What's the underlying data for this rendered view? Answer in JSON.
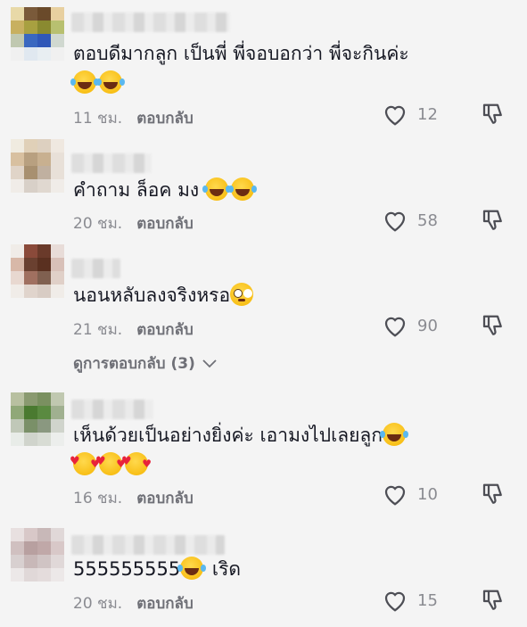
{
  "comments": [
    {
      "text": "ตอบดีมากลูก เป็นพี่ พี่จอบอกว่า พี่จะกินค่ะ",
      "emojis_after": [
        "laugh",
        "laugh"
      ],
      "time": "11 ชม.",
      "reply_label": "ตอบกลับ",
      "likes": "12",
      "avatar": [
        "#e8d9a8",
        "#7a5a3a",
        "#6a4a2a",
        "#e8d0a0",
        "#c8b060",
        "#a8a040",
        "#8a8a30",
        "#b8c070",
        "#c0c8b0",
        "#3a68c0",
        "#3058b8",
        "#d0d8d0",
        "#f0f0f0",
        "#e0e8f0",
        "#e8eef2",
        "#f0f0f0"
      ]
    },
    {
      "text": "คำถาม ล็อค มง",
      "emojis_inline": [
        "laugh",
        "laugh"
      ],
      "time": "20 ชม.",
      "reply_label": "ตอบกลับ",
      "likes": "58",
      "avatar": [
        "#f0ebe0",
        "#e0d0b8",
        "#ddd0c0",
        "#efe8e0",
        "#d8c0a0",
        "#b8a080",
        "#c8b090",
        "#e8e0d8",
        "#e0d4c8",
        "#a89070",
        "#c0b0a0",
        "#e8e0d8",
        "#f0ece8",
        "#d8d0c8",
        "#e0d8d0",
        "#f0ece8"
      ]
    },
    {
      "text": "นอนหลับลงจริงหรอ",
      "emojis_inline": [
        "flush"
      ],
      "time": "21 ชม.",
      "reply_label": "ตอบกลับ",
      "likes": "90",
      "view_replies": "ดูการตอบกลับ (3)",
      "avatar": [
        "#f0ece8",
        "#8a4a3a",
        "#6a3a2a",
        "#e8dcd8",
        "#d8b8a8",
        "#6a4030",
        "#5a3020",
        "#d8c0b8",
        "#e8d8d0",
        "#a07060",
        "#806050",
        "#e0d0c8",
        "#f0ece8",
        "#e0d4cc",
        "#d8ccc4",
        "#f0ece8"
      ]
    },
    {
      "text": "เห็นด้วยเป็นอย่างยิ่งค่ะ เอามงไปเลยลูก",
      "emojis_line2": [
        "hearts",
        "hearts",
        "hearts"
      ],
      "emojis_inline": [
        "laugh"
      ],
      "time": "16 ชม.",
      "reply_label": "ตอบกลับ",
      "likes": "10",
      "avatar": [
        "#b8c0a0",
        "#8a9a70",
        "#7a9060",
        "#c0c8b0",
        "#90a878",
        "#4a7a30",
        "#5a8a40",
        "#a0b090",
        "#c0c8b8",
        "#7a9068",
        "#8a9880",
        "#d0d4cc",
        "#e8ece8",
        "#d0d4cc",
        "#d8dcd4",
        "#eceeec"
      ]
    },
    {
      "text": "555555555",
      "text_after": " เริด",
      "emojis_inline": [
        "laugh"
      ],
      "time": "20 ชม.",
      "reply_label": "ตอบกลับ",
      "likes": "15",
      "avatar": [
        "#e8e0e0",
        "#d8c8c8",
        "#c8b8b8",
        "#e0d8d8",
        "#d0c0c0",
        "#b8a0a0",
        "#c0a8a8",
        "#d8c8c8",
        "#d8d0d0",
        "#c8b8b8",
        "#d0c4c4",
        "#e0d8d8",
        "#ece8e8",
        "#e0d8d8",
        "#e4dcdc",
        "#ece8e8"
      ]
    }
  ],
  "icons": {
    "like": "heart-outline-icon",
    "dislike": "thumbs-down-icon",
    "expand": "chevron-down-icon"
  },
  "colors": {
    "text": "#161823",
    "meta": "#8a8b91",
    "background": "#f4f4f4"
  }
}
